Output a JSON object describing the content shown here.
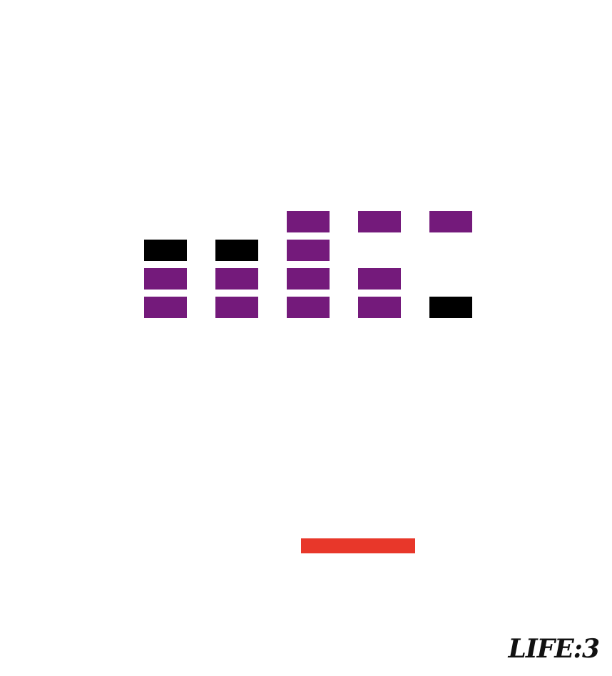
{
  "game": {
    "lives_label": "LIFE:3",
    "lives": 3
  },
  "colors": {
    "brick_strong": "#741A7B",
    "brick_hardened": "#000000",
    "paddle": "#E8372A",
    "background": "#FFFFFF"
  },
  "bricks": {
    "columns": [
      {
        "col": 1,
        "cells": [
          "empty",
          "hardened",
          "strong",
          "strong"
        ]
      },
      {
        "col": 2,
        "cells": [
          "empty",
          "hardened",
          "strong",
          "strong"
        ]
      },
      {
        "col": 3,
        "cells": [
          "strong",
          "strong",
          "strong",
          "strong"
        ]
      },
      {
        "col": 4,
        "cells": [
          "strong",
          "empty",
          "strong",
          "strong"
        ]
      },
      {
        "col": 5,
        "cells": [
          "strong",
          "empty",
          "empty",
          "hardened"
        ]
      }
    ]
  }
}
